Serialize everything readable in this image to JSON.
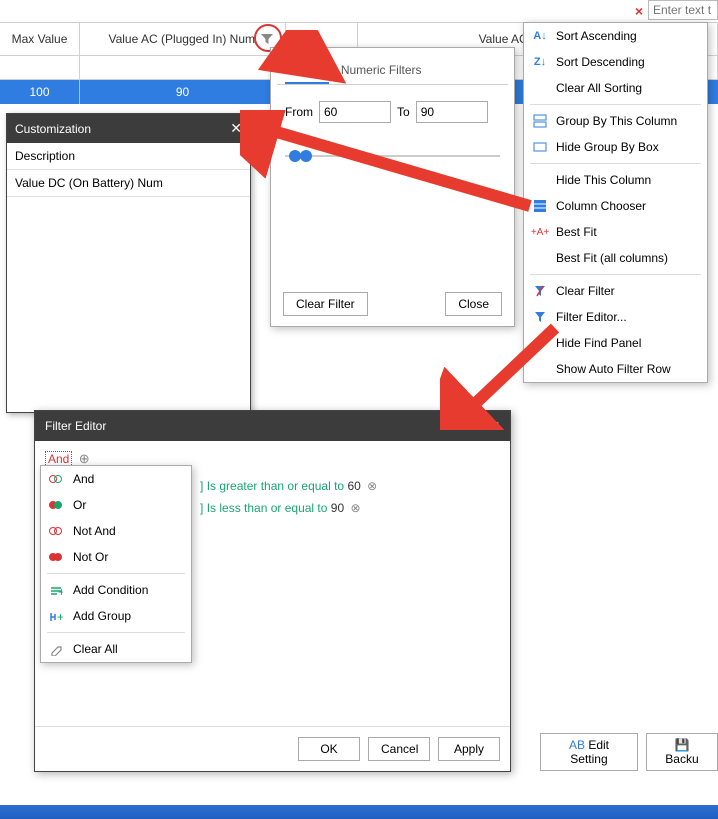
{
  "top": {
    "close_x": "×",
    "placeholder": "Enter text t"
  },
  "headers": {
    "max": "Max Value",
    "vac_num": "Value AC (Plugged In) Num",
    "vac": "Value AC (Plugged In)"
  },
  "data": {
    "max": "100",
    "vacn": "90"
  },
  "cust": {
    "title": "Customization",
    "items": [
      "Description",
      "Value DC (On Battery) Num"
    ]
  },
  "valpop": {
    "tab_values": "Values",
    "tab_nf": "Numeric Filters",
    "from": "From",
    "to": "To",
    "from_v": "60",
    "to_v": "90",
    "clear": "Clear Filter",
    "close": "Close"
  },
  "ctx": {
    "sort_asc": "Sort Ascending",
    "sort_desc": "Sort Descending",
    "clear_sort": "Clear All Sorting",
    "group_by": "Group By This Column",
    "hide_group": "Hide Group By Box",
    "hide_col": "Hide This Column",
    "col_chooser": "Column Chooser",
    "best_fit": "Best Fit",
    "best_fit_all": "Best Fit (all columns)",
    "clear_filter": "Clear Filter",
    "filter_editor": "Filter Editor...",
    "hide_find": "Hide Find Panel",
    "show_auto": "Show Auto Filter Row"
  },
  "fed": {
    "title": "Filter Editor",
    "and": "And",
    "field_suffix": "]",
    "cond1_op": "Is greater than or equal to",
    "cond1_v": "60",
    "cond2_op": "Is less than or equal to",
    "cond2_v": "90",
    "ok": "OK",
    "cancel": "Cancel",
    "apply": "Apply"
  },
  "and_menu": {
    "and": "And",
    "or": "Or",
    "not_and": "Not And",
    "not_or": "Not Or",
    "add_cond": "Add Condition",
    "add_group": "Add Group",
    "clear_all": "Clear All"
  },
  "bottom": {
    "edit": "Edit Setting",
    "backup": "Backu"
  }
}
